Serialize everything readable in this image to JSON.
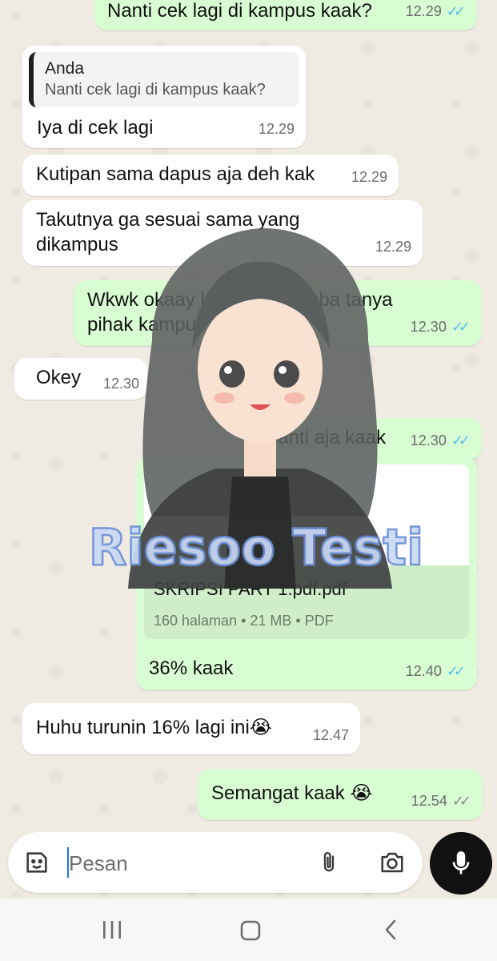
{
  "messages": [
    {
      "dir": "out",
      "text": "Nanti cek lagi di kampus kaak?",
      "time": "12.29",
      "status": "read"
    },
    {
      "dir": "in",
      "quote": {
        "author": "Anda",
        "text": "Nanti cek lagi di kampus kaak?"
      },
      "text": "Iya di cek lagi",
      "time": "12.29"
    },
    {
      "dir": "in",
      "text": "Kutipan sama dapus aja deh kak",
      "time": "12.29"
    },
    {
      "dir": "in",
      "text": "Takutnya ga sesuai sama yang\ndikampus",
      "time": "12.29"
    },
    {
      "dir": "out",
      "text": "Wkwk okaay kaak, nanti coba tanya\npihak kampus aja kaak",
      "time": "12.30",
      "status": "read"
    },
    {
      "dir": "in",
      "text": "Okey",
      "time": "12.30"
    },
    {
      "dir": "out",
      "text": "Nanti aja kaak",
      "time": "12.30",
      "status": "read"
    },
    {
      "dir": "out",
      "document": {
        "name": "SKRIPSI PART 1.pdf.pdf",
        "info": "160 halaman • 21 MB • PDF"
      },
      "text": "36% kaak",
      "time": "12.40",
      "status": "read"
    },
    {
      "dir": "in",
      "text": "Huhu turunin 16% lagi ini😭",
      "time": "12.47"
    },
    {
      "dir": "out",
      "text": "Semangat kaak 😭",
      "time": "12.54",
      "status": "delivered"
    }
  ],
  "ticks": {
    "read": "✓✓",
    "delivered": "✓✓"
  },
  "watermark": {
    "text": "Riesoo Testi"
  },
  "composer": {
    "placeholder": "Pesan"
  },
  "icons": [
    "sticker-icon",
    "attach-icon",
    "camera-icon",
    "mic-icon",
    "recent-apps-icon",
    "home-icon",
    "back-icon"
  ],
  "colors": {
    "incoming": "#ffffff",
    "outgoing": "#d9fdd3",
    "read_tick": "#53bdeb",
    "delivered_tick": "#8a8a8a"
  }
}
